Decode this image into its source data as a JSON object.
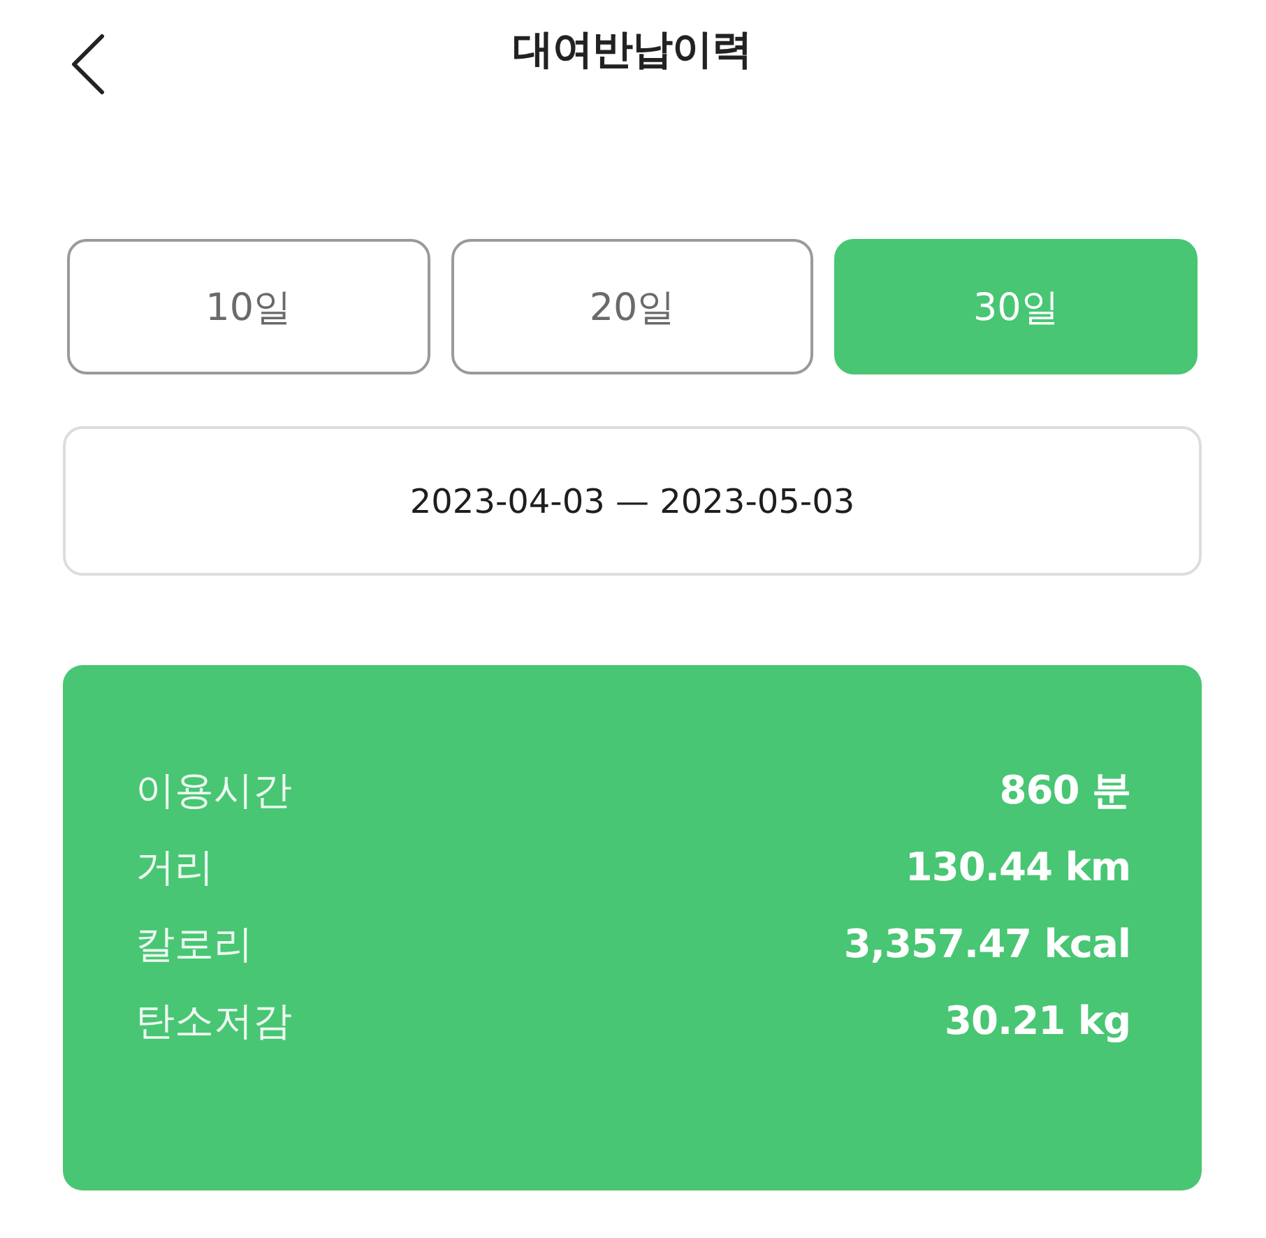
{
  "header": {
    "title": "대여반납이력"
  },
  "period_tabs": [
    {
      "label": "10일",
      "selected": false
    },
    {
      "label": "20일",
      "selected": false
    },
    {
      "label": "30일",
      "selected": true
    }
  ],
  "date_range": {
    "value": "2023-04-03 — 2023-05-03"
  },
  "summary": {
    "rows": [
      {
        "label": "이용시간",
        "value": "860 분"
      },
      {
        "label": "거리",
        "value": "130.44 km"
      },
      {
        "label": "칼로리",
        "value": "3,357.47 kcal"
      },
      {
        "label": "탄소저감",
        "value": "30.21 kg"
      }
    ]
  }
}
